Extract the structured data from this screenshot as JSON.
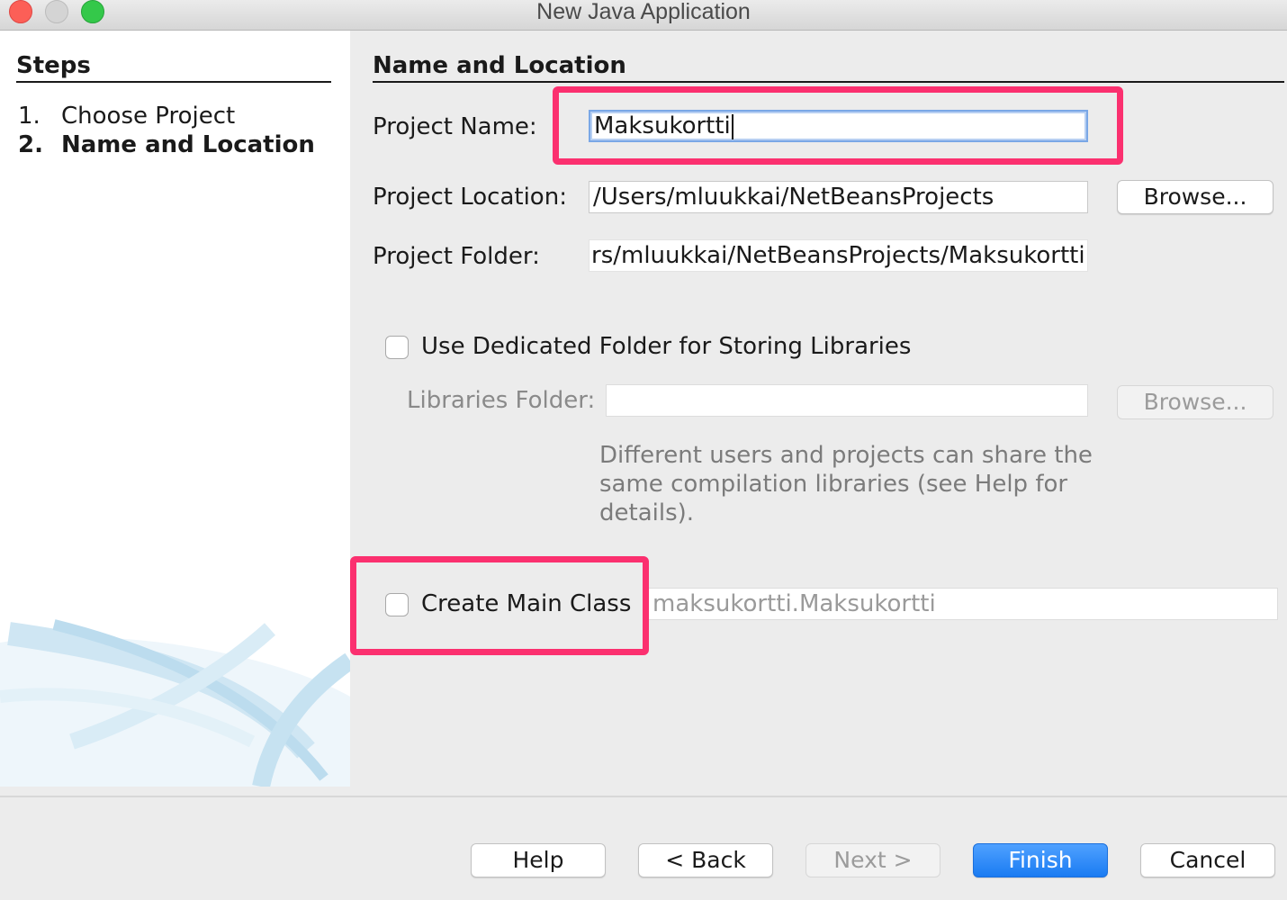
{
  "window": {
    "title": "New Java Application"
  },
  "steps": {
    "heading": "Steps",
    "items": [
      {
        "num": "1.",
        "label": "Choose Project"
      },
      {
        "num": "2.",
        "label": "Name and Location"
      }
    ]
  },
  "panel": {
    "heading": "Name and Location",
    "project_name_label": "Project Name:",
    "project_name_value": "Maksukortti",
    "project_location_label": "Project Location:",
    "project_location_value": "/Users/mluukkai/NetBeansProjects",
    "project_location_browse": "Browse...",
    "project_folder_label": "Project Folder:",
    "project_folder_value": "rs/mluukkai/NetBeansProjects/Maksukortti",
    "dedicated_folder_label": "Use Dedicated Folder for Storing Libraries",
    "libraries_folder_label": "Libraries Folder:",
    "libraries_folder_value": "",
    "libraries_browse": "Browse...",
    "libraries_help": "Different users and projects can share the same compilation libraries (see Help for details).",
    "create_main_class_label": "Create Main Class",
    "main_class_value": "maksukortti.Maksukortti"
  },
  "buttons": {
    "help": "Help",
    "back": "< Back",
    "next": "Next >",
    "finish": "Finish",
    "cancel": "Cancel"
  },
  "colors": {
    "highlight": "#fb306f",
    "primary_button": "#1a7bf2",
    "focus_border": "#7aa7e6"
  }
}
